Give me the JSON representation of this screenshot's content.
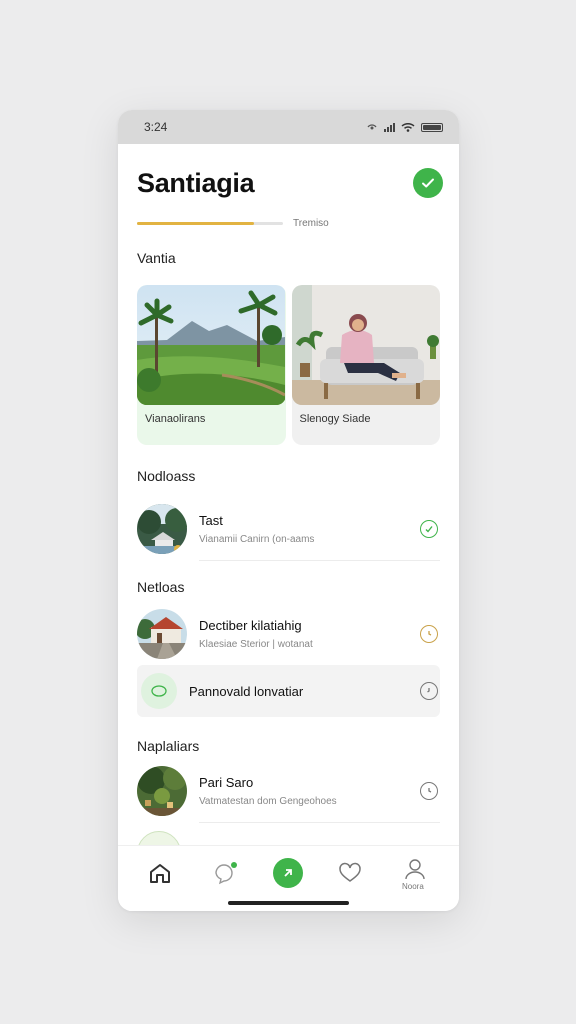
{
  "status_bar": {
    "time": "3:24"
  },
  "header": {
    "title": "Santiagia",
    "progress_label": "Tremiso",
    "progress_value": 0.8
  },
  "section1": {
    "label": "Vantia"
  },
  "cards": [
    {
      "label": "Vianaolirans",
      "icon": "landscape-photo"
    },
    {
      "label": "Slenogy Siade",
      "icon": "person-photo"
    }
  ],
  "section2": {
    "label": "Nodloass"
  },
  "item1": {
    "title": "Tast",
    "subtitle": "Vianamii Canirn (on-aams"
  },
  "section3": {
    "label": "Netloas"
  },
  "item2": {
    "title": "Dectiber kilatiahig",
    "subtitle": "Klaesiae Sterior | wotanat"
  },
  "item3": {
    "title": "Pannovald lonvatiar"
  },
  "section4": {
    "label": "Naplaliars"
  },
  "item4": {
    "title": "Pari Saro",
    "subtitle": "Vatmatestan dom Gengeohoes"
  },
  "tabs": {
    "profile_label": "Noora"
  },
  "colors": {
    "accent_green": "#3fb44a",
    "progress_yellow": "#e2b341"
  }
}
